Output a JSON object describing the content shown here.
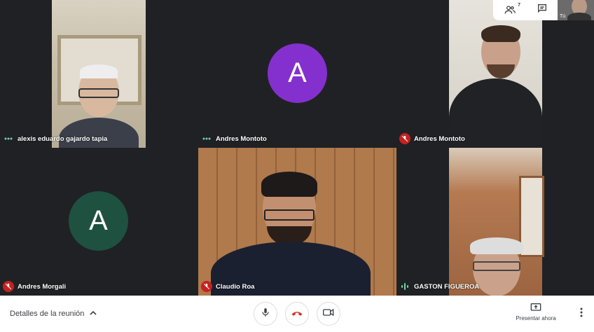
{
  "participants": [
    {
      "name": "alexis eduardo gajardo tapia",
      "status": "speaking"
    },
    {
      "name": "Andres Montoto",
      "status": "speaking",
      "avatar_letter": "A",
      "avatar_color": "#8430ce"
    },
    {
      "name": "Andres Montoto",
      "status": "muted"
    },
    {
      "name": "Andres Morgali",
      "status": "muted",
      "avatar_letter": "A",
      "avatar_color": "#1e5140"
    },
    {
      "name": "Claudio Roa",
      "status": "muted"
    },
    {
      "name": "GASTON FIGUEROA",
      "status": "speaking"
    }
  ],
  "self_view": {
    "label": "Tú"
  },
  "topbar": {
    "icons": [
      "people-icon",
      "chat-icon"
    ],
    "people_count": "7"
  },
  "bottom": {
    "details_label": "Detalles de la reunión",
    "present_label": "Presentar ahora"
  },
  "colors": {
    "muted": "#c5221f",
    "speaking": "#6dd5a0",
    "end_call": "#d93025"
  }
}
